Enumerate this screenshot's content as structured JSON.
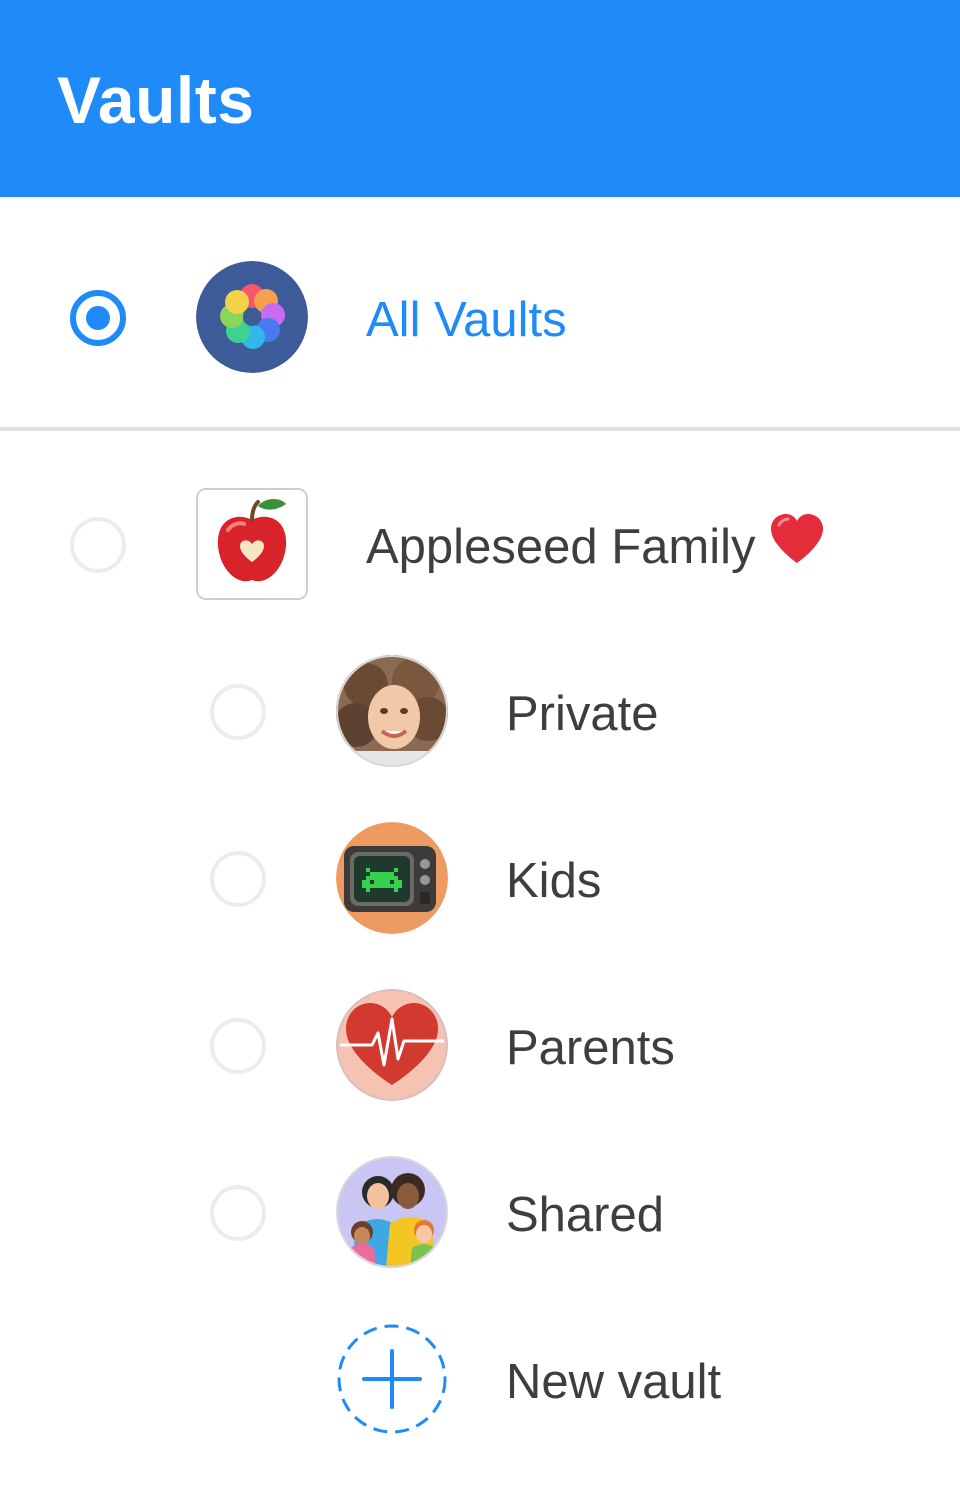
{
  "header": {
    "title": "Vaults",
    "background_color": "#1f8bf9"
  },
  "all_vaults": {
    "label": "All Vaults",
    "selected": true,
    "icon": "multicolor-flower-icon",
    "accent_color": "#1f8bf9"
  },
  "account": {
    "label": "Appleseed Family",
    "emoji_icon": "red-heart-icon",
    "icon": "apple-heart-icon",
    "selected": false
  },
  "vaults": [
    {
      "label": "Private",
      "icon": "woman-portrait-avatar",
      "selected": false
    },
    {
      "label": "Kids",
      "icon": "retro-tv-space-invader-avatar",
      "selected": false
    },
    {
      "label": "Parents",
      "icon": "heartbeat-heart-avatar",
      "selected": false
    },
    {
      "label": "Shared",
      "icon": "family-group-avatar",
      "selected": false
    }
  ],
  "new_vault": {
    "label": "New vault",
    "icon": "plus-icon"
  }
}
